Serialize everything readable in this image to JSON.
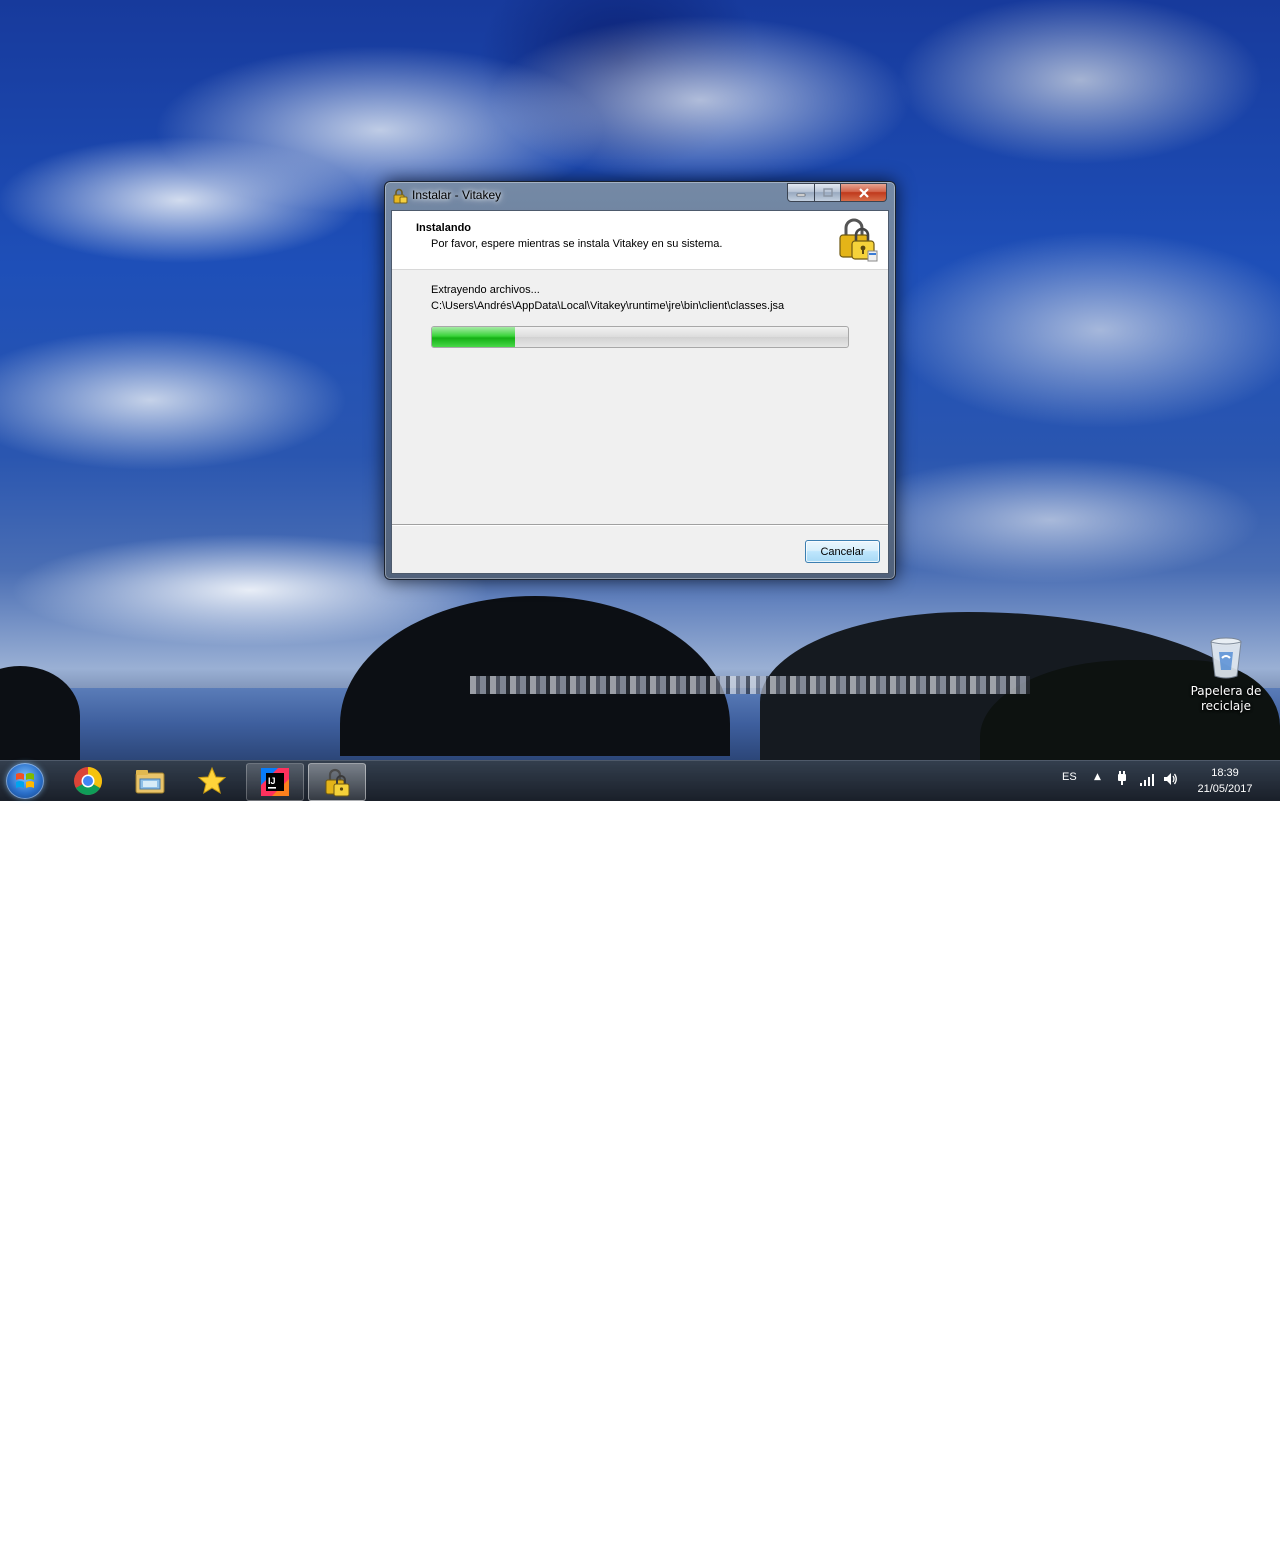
{
  "window": {
    "title": "Instalar - Vitakey",
    "heading": "Instalando",
    "subheading": "Por favor, espere mientras se instala Vitakey en su sistema.",
    "status": "Extrayendo archivos...",
    "file_path": "C:\\Users\\Andrés\\AppData\\Local\\Vitakey\\runtime\\jre\\bin\\client\\classes.jsa",
    "progress_fraction": 0.2,
    "cancel_label": "Cancelar"
  },
  "desktop": {
    "recycle_bin_label_line1": "Papelera de",
    "recycle_bin_label_line2": "reciclaje"
  },
  "taskbar": {
    "items": [
      "start-button",
      "chrome-icon",
      "file-explorer-icon",
      "star-icon",
      "intellij-icon",
      "vitakey-installer-icon"
    ],
    "language": "ES",
    "time": "18:39",
    "date": "21/05/2017"
  },
  "colors": {
    "progress_green": "#14b014",
    "taskbar": "#1a2230",
    "close_button": "#c0391c"
  }
}
